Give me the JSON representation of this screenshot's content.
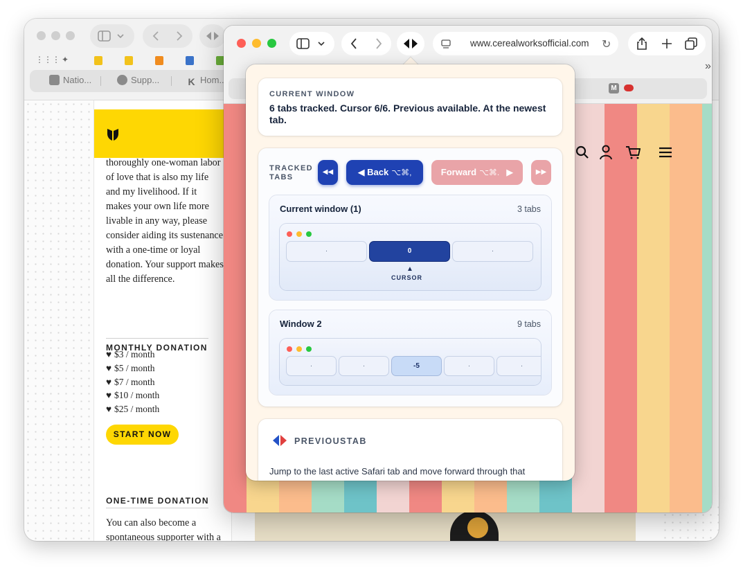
{
  "back_window": {
    "tabs": [
      {
        "label": "Natio...",
        "icon": "document-icon"
      },
      {
        "label": "Supp...",
        "icon": "circle-icon"
      },
      {
        "label": "Hom...",
        "icon": "k-icon",
        "glyph": "K"
      }
    ],
    "paragraph": "thoroughly one-woman labor of love that is also my life and my livelihood. If it makes your own life more livable in any way, please consider aiding its sustenance with a one-time or loyal donation. Your support makes all the difference.",
    "monthly_heading": "MONTHLY DONATION",
    "monthly_options": [
      "$3 / month",
      "$5 / month",
      "$7 / month",
      "$10 / month",
      "$25 / month"
    ],
    "start_button": "START NOW",
    "one_time_heading": "ONE-TIME DONATION",
    "one_time_text": "You can also become a spontaneous supporter with a one-time"
  },
  "front_window": {
    "url": "www.cerealworksofficial.com",
    "tab_badge": "M",
    "stripe_colors": [
      "#f08883",
      "#f8d68e",
      "#fbbc8c",
      "#a5dcc6",
      "#6ec3c8",
      "#f2d4d2"
    ]
  },
  "popover": {
    "current_window_caption": "CURRENT WINDOW",
    "status": "6 tabs tracked. Cursor 6/6. Previous available. At the newest tab.",
    "tracked_caption": "TRACKED TABS",
    "first_button": "◀◀",
    "back_button": "◀  Back",
    "back_shortcut": "⌥⌘,",
    "forward_button": "Forward",
    "forward_shortcut": "⌥⌘.",
    "forward_arrow": "▶",
    "last_button": "▶▶",
    "windows": [
      {
        "title": "Current window (1)",
        "count": "3 tabs",
        "tabs": [
          "·",
          "0",
          "·"
        ],
        "cursor_label": "CURSOR"
      },
      {
        "title": "Window 2",
        "count": "9 tabs",
        "tabs": [
          "·",
          "·",
          "-5",
          "·",
          "·"
        ]
      }
    ],
    "app_name": "PREVIOUSTAB",
    "app_description": "Jump to the last active Safari tab and move forward through that history when needed."
  }
}
